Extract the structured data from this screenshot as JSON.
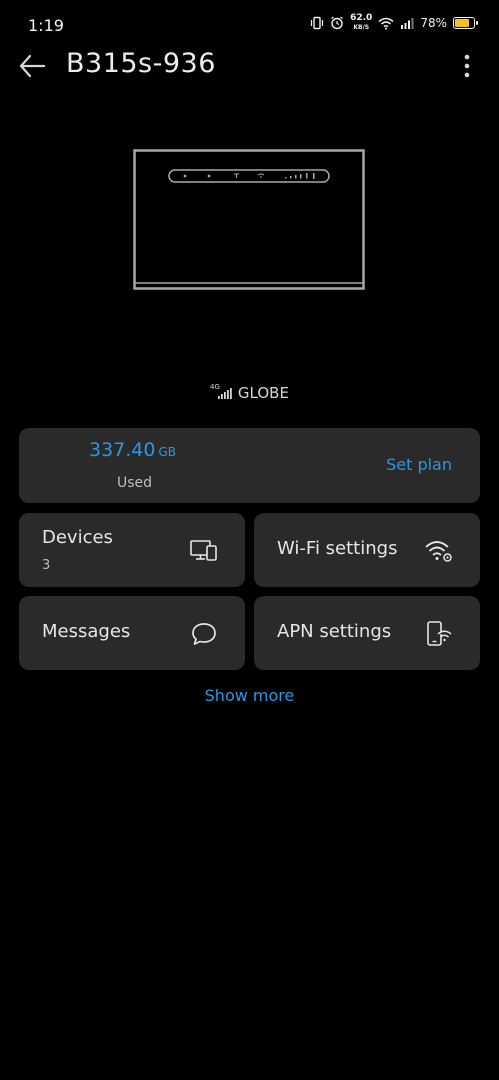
{
  "status_bar": {
    "time": "1:19",
    "speed_value": "62.0",
    "speed_unit": "KB/S",
    "battery_percent": "78%",
    "battery_level": 0.78
  },
  "header": {
    "title": "B315s-936"
  },
  "carrier": {
    "network_type": "4G",
    "name": "GLOBE"
  },
  "usage": {
    "value": "337.40",
    "unit": "GB",
    "label": "Used",
    "set_plan_label": "Set plan"
  },
  "tiles": {
    "devices": {
      "label": "Devices",
      "count": "3",
      "icon": "devices-icon"
    },
    "wifi": {
      "label": "Wi-Fi settings",
      "icon": "wifi-settings-icon"
    },
    "messages": {
      "label": "Messages",
      "icon": "message-icon"
    },
    "apn": {
      "label": "APN settings",
      "icon": "apn-phone-icon"
    }
  },
  "show_more_label": "Show more",
  "colors": {
    "accent": "#2b97e0",
    "card_bg": "#2a2a2a",
    "background": "#000000",
    "battery": "#f3c21b"
  }
}
